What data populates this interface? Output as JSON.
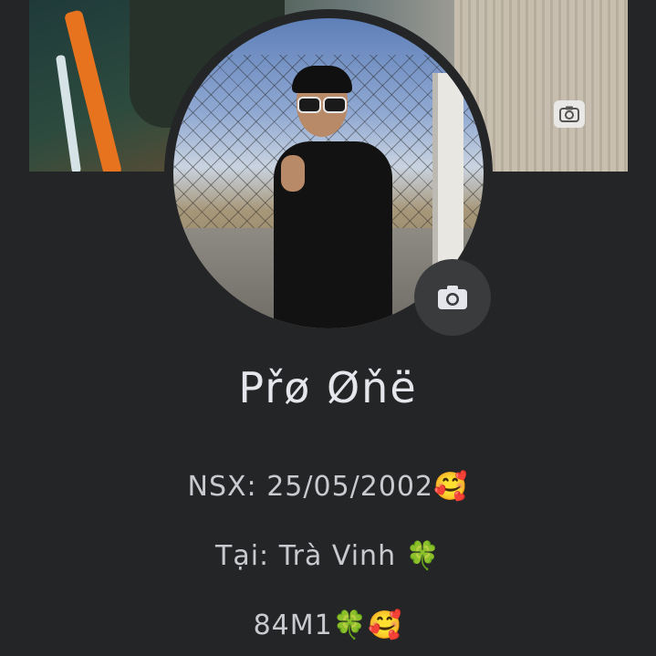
{
  "profile": {
    "name": "Přø Øňë",
    "bio": [
      "NSX: 25/05/2002🥰",
      "Tại: Trà Vinh 🍀",
      "84M1🍀🥰"
    ]
  },
  "icons": {
    "cover_camera": "camera-icon",
    "avatar_camera": "camera-icon"
  },
  "colors": {
    "background": "#242526",
    "text_primary": "#e4e6eb",
    "text_secondary": "#c8cacf",
    "camera_button": "#3a3b3c"
  }
}
